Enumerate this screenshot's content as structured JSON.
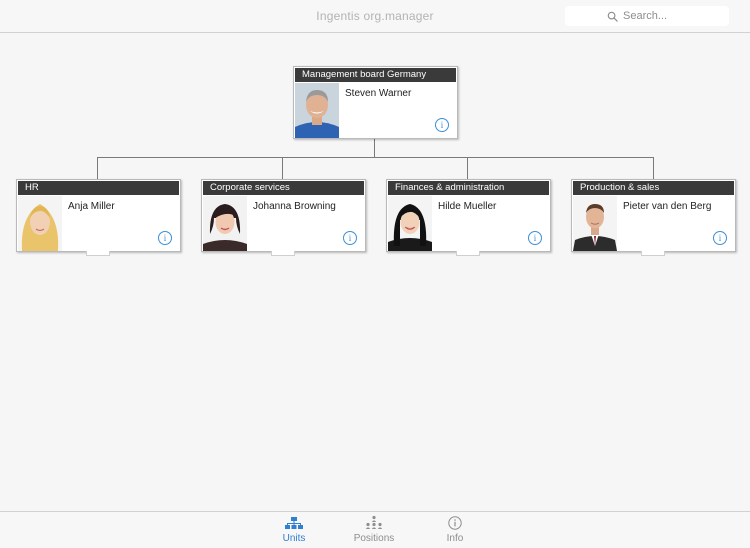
{
  "header": {
    "title": "Ingentis org.manager",
    "search_placeholder": "Search..."
  },
  "org": {
    "root": {
      "unit": "Management board Germany",
      "person": "Steven Warner",
      "photo": "man-gray-hair",
      "info_icon": "i"
    },
    "children": [
      {
        "unit": "HR",
        "person": "Anja Miller",
        "photo": "woman-blonde",
        "info_icon": "i"
      },
      {
        "unit": "Corporate services",
        "person": "Johanna Browning",
        "photo": "woman-dark-hair",
        "info_icon": "i"
      },
      {
        "unit": "Finances & administration",
        "person": "Hilde Mueller",
        "photo": "woman-black-hair",
        "info_icon": "i"
      },
      {
        "unit": "Production & sales",
        "person": "Pieter van den Berg",
        "photo": "man-suit",
        "info_icon": "i"
      }
    ]
  },
  "tabbar": {
    "tabs": [
      {
        "label": "Units",
        "icon": "units-icon",
        "active": true
      },
      {
        "label": "Positions",
        "icon": "positions-icon",
        "active": false
      },
      {
        "label": "Info",
        "icon": "info-icon",
        "active": false
      }
    ]
  },
  "colors": {
    "accent": "#2f7fd2",
    "card_header": "#3a3a3a",
    "connector": "#7a7a7a"
  }
}
